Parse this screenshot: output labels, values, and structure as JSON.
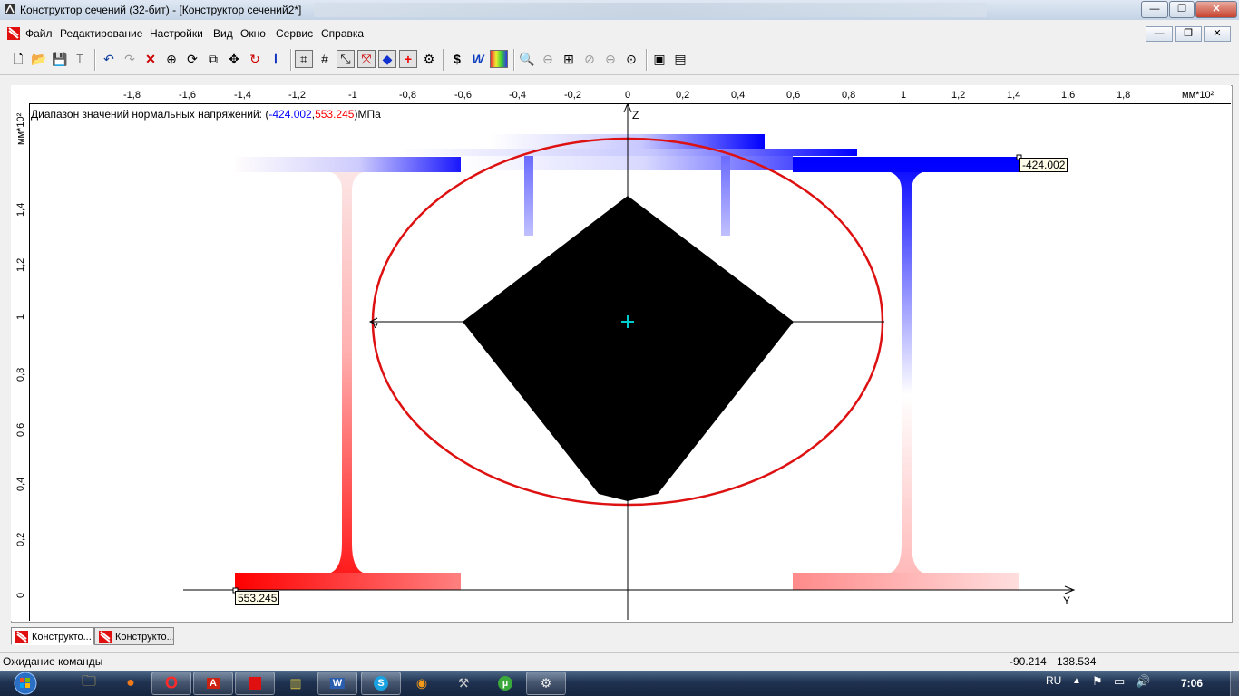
{
  "window": {
    "title": "Конструктор сечений (32-бит) - [Конструктор сечений2*]",
    "buttons": {
      "minimize": "—",
      "maximize": "❐",
      "close": "✕"
    }
  },
  "menu": [
    "Файл",
    "Редактирование",
    "Настройки",
    "Вид",
    "Окно",
    "Сервис",
    "Справка"
  ],
  "mdi_buttons": {
    "minimize": "—",
    "restore": "❐",
    "close": "✕"
  },
  "toolbar": {
    "icons": [
      "new-file-icon",
      "open-folder-icon",
      "save-icon",
      "page-setup-icon",
      "undo-icon",
      "redo-icon",
      "delete-icon",
      "snap-icon",
      "pick-icon",
      "copy-icon",
      "move-icon",
      "rotate-icon",
      "section-icon",
      "grid-snap-icon",
      "grid-icon",
      "contour-icon",
      "stress-icon",
      "point-icon",
      "origin-icon",
      "calc-icon",
      "dollar-icon",
      "report-icon",
      "palette-icon",
      "zoom-in-icon",
      "zoom-out-icon",
      "zoom-window-icon",
      "zoom-prev-icon",
      "zoom-next-icon",
      "zoom-extents-icon",
      "layout-icon",
      "export-icon"
    ]
  },
  "canvas": {
    "x_ticks": [
      "-1,8",
      "-1,6",
      "-1,4",
      "-1,2",
      "-1",
      "-0,8",
      "-0,6",
      "-0,4",
      "-0,2",
      "0",
      "0,2",
      "0,4",
      "0,6",
      "0,8",
      "1",
      "1,2",
      "1,4",
      "1,6",
      "1,8"
    ],
    "x_unit": "мм*10²",
    "y_ticks": [
      "0",
      "0,2",
      "0,4",
      "0,6",
      "0,8",
      "1",
      "1,2",
      "1,4"
    ],
    "y_unit": "мм*10²",
    "range": {
      "prefix": "Диапазон значений нормальных напряжений: (",
      "min": "-424.002",
      "sep": ",",
      "max": "553.245",
      "suffix": ")МПа"
    },
    "axis_z": "Z",
    "axis_y": "Y",
    "axis_v": "v",
    "max_tag": "-424.002",
    "min_tag": "553.245",
    "colors": {
      "compression": "#0000ff",
      "tension": "#ff0000",
      "ellipse": "#dd1111",
      "core": "#000000",
      "centroid": "#00cccc"
    }
  },
  "tabs": [
    {
      "label": "Конструкто...",
      "active": true
    },
    {
      "label": "Конструкто...",
      "active": false
    }
  ],
  "status": {
    "text": "Ожидание команды",
    "x": "-90.214",
    "y": "138.534"
  },
  "taskbar": {
    "items": [
      "start-orb-icon",
      "explorer-icon",
      "firefox-icon",
      "opera-icon",
      "acrobat-icon",
      "section-app-icon",
      "archive-icon",
      "word-icon",
      "skype-icon",
      "avast-icon",
      "utility-icon",
      "utorrent-icon",
      "app-icon"
    ],
    "lang": "RU",
    "clock": "7:06"
  }
}
